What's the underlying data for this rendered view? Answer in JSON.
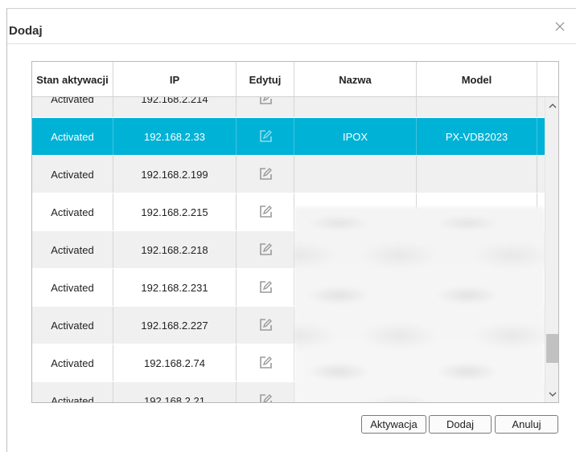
{
  "dialog": {
    "title": "Dodaj"
  },
  "table": {
    "columns": [
      "Stan aktywacji",
      "IP",
      "Edytuj",
      "Nazwa",
      "Model"
    ],
    "rows": [
      {
        "status": "Activated",
        "ip": "192.168.2.214",
        "name": "",
        "model": ""
      },
      {
        "status": "Activated",
        "ip": "192.168.2.33",
        "name": "IPOX",
        "model": "PX-VDB2023",
        "selected": true
      },
      {
        "status": "Activated",
        "ip": "192.168.2.199",
        "name": "",
        "model": ""
      },
      {
        "status": "Activated",
        "ip": "192.168.2.215",
        "name": "",
        "model": ""
      },
      {
        "status": "Activated",
        "ip": "192.168.2.218",
        "name": "",
        "model": ""
      },
      {
        "status": "Activated",
        "ip": "192.168.2.231",
        "name": "",
        "model": ""
      },
      {
        "status": "Activated",
        "ip": "192.168.2.227",
        "name": "",
        "model": ""
      },
      {
        "status": "Activated",
        "ip": "192.168.2.74",
        "name": "",
        "model": ""
      },
      {
        "status": "Activated",
        "ip": "192.168.2.21",
        "name": "",
        "model": ""
      }
    ]
  },
  "buttons": {
    "activate": "Aktywacja",
    "add": "Dodaj",
    "cancel": "Anuluj"
  },
  "colors": {
    "selection": "#00b2d6"
  },
  "icons": {
    "close": "close-icon",
    "edit": "edit-icon",
    "scroll_up": "chevron-up-icon",
    "scroll_down": "chevron-down-icon"
  }
}
